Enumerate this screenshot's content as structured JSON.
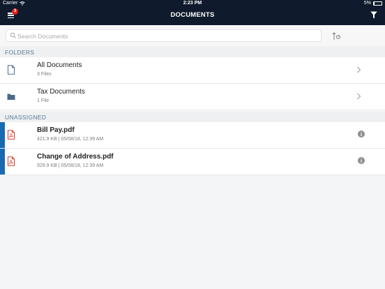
{
  "status_bar": {
    "carrier": "Carrier",
    "time": "2:23 PM",
    "battery": "5%",
    "battery_level": 0.05
  },
  "header": {
    "title": "DOCUMENTS",
    "badge_count": "3"
  },
  "search": {
    "placeholder": "Search Documents"
  },
  "folders_section": {
    "label": "FOLDERS",
    "items": [
      {
        "title": "All Documents",
        "subtitle": "3 Files",
        "icon": "document-outline-icon"
      },
      {
        "title": "Tax Documents",
        "subtitle": "1 File",
        "icon": "folder-icon"
      }
    ]
  },
  "unassigned_section": {
    "label": "UNASSIGNED",
    "items": [
      {
        "title": "Bill Pay.pdf",
        "subtitle": "421.9 KB | 05/08/18, 12:39 AM",
        "icon": "pdf-icon"
      },
      {
        "title": "Change of Address.pdf",
        "subtitle": "929.9 KB | 05/08/18, 12:39 AM",
        "icon": "pdf-icon"
      }
    ]
  },
  "colors": {
    "header_bg": "#0f1a2c",
    "badge": "#e0201a",
    "accent_bar": "#1a6ab1",
    "pdf_red": "#d83a2e",
    "section_text": "#5a7a93"
  }
}
